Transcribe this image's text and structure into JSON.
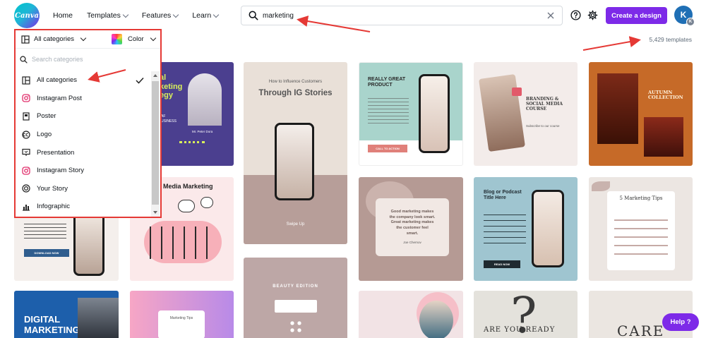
{
  "header": {
    "logo_text": "Canva",
    "nav": [
      {
        "label": "Home",
        "has_chevron": false
      },
      {
        "label": "Templates",
        "has_chevron": true
      },
      {
        "label": "Features",
        "has_chevron": true
      },
      {
        "label": "Learn",
        "has_chevron": true
      }
    ],
    "search_value": "marketing",
    "help_icon": "question-circle-icon",
    "settings_icon": "gear-icon",
    "create_button": "Create a design",
    "avatar_initial": "K",
    "avatar_sub_initial": "K"
  },
  "results": {
    "count_text": "5,429 templates"
  },
  "dropdown": {
    "category_label": "All categories",
    "color_label": "Color",
    "search_placeholder": "Search categories",
    "items": [
      {
        "label": "All categories",
        "icon": "layout-icon",
        "selected": true
      },
      {
        "label": "Instagram Post",
        "icon": "instagram-icon",
        "selected": false
      },
      {
        "label": "Poster",
        "icon": "poster-icon",
        "selected": false
      },
      {
        "label": "Logo",
        "icon": "logo-icon",
        "selected": false
      },
      {
        "label": "Presentation",
        "icon": "presentation-icon",
        "selected": false
      },
      {
        "label": "Instagram Story",
        "icon": "instagram-icon",
        "selected": false
      },
      {
        "label": "Your Story",
        "icon": "your-story-icon",
        "selected": false
      },
      {
        "label": "Infographic",
        "icon": "bar-chart-icon",
        "selected": false
      }
    ]
  },
  "templates": {
    "c1_title": "al\nketing\negy",
    "c1_sub": "AF\nUSINESS",
    "c1_person": "Mr. Peter Dora",
    "c2_title": "How to Influence Customers",
    "c2_big": "Through IG Stories",
    "c2_swipe": "Swipe Up",
    "c3_title": "REALLY GREAT\nPRODUCT",
    "c3_btn": "CALL TO ACTION",
    "c4_title": "BRANDING &\nSOCIAL MEDIA\nCOURSE",
    "c4_sub": "Subscribe to our course",
    "c5_title": "AUTUMN\nCOLLECTION",
    "c6_title": "l Media Marketing",
    "c7_quote": "Good marketing makes\nthe company look smart.\nGreat marketing makes\nthe customer feel\nsmart.",
    "c7_author": "Joe Chernov",
    "c8_title": "Blog or Podcast\nTitle Here",
    "c8_btn": "READ NOW",
    "c9_title": "5 Marketing Tips",
    "c10_btn": "DOWNLOAD NOW",
    "c11_title": "DIGITAL\nMARKETING",
    "c12_title": "Marketing Tips",
    "c13_title": "BEAUTY EDITION",
    "c14_title": "ARE YOU READY",
    "c15_title": "CARE",
    "help_button": "Help ?"
  },
  "colors": {
    "brand_purple": "#7d2ae8",
    "annotation_red": "#e53935",
    "teal": "#00c4cc"
  }
}
